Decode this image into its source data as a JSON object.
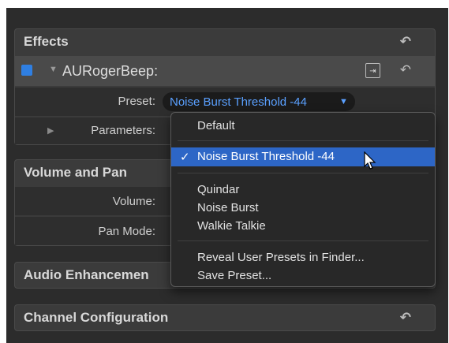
{
  "sections": {
    "effects": "Effects",
    "volume_pan": "Volume and Pan",
    "audio_enh": "Audio Enhancemen",
    "channel": "Channel Configuration"
  },
  "effect": {
    "name": "AURogerBeep:",
    "color": "#2f7fe2",
    "preset_label": "Preset:",
    "preset_value": "Noise Burst Threshold -44",
    "parameters_label": "Parameters:"
  },
  "volume": {
    "volume_label": "Volume:",
    "pan_mode_label": "Pan Mode:"
  },
  "menu": {
    "default": "Default",
    "selected": "Noise Burst Threshold -44",
    "check": "✓",
    "items": [
      "Quindar",
      "Noise Burst",
      "Walkie Talkie"
    ],
    "reveal": "Reveal User Presets in Finder...",
    "save": "Save Preset..."
  },
  "colors": {
    "highlight": "#2d66c6",
    "preset_text": "#5aa0ff",
    "panel": "#2c2c2c"
  }
}
